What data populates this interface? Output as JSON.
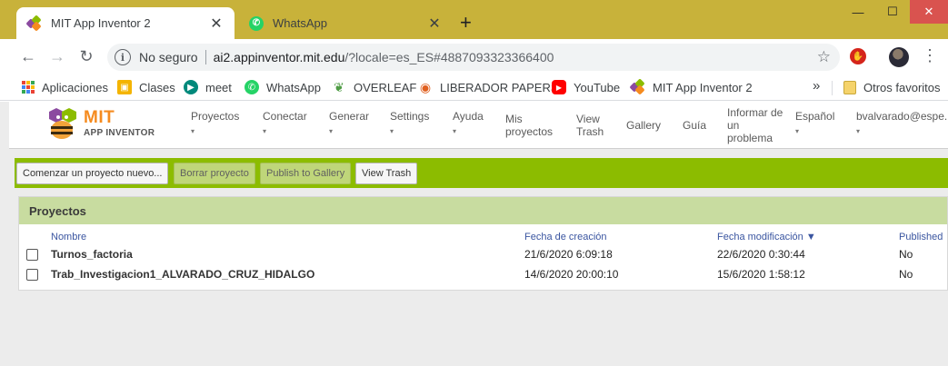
{
  "browser": {
    "tabs": [
      {
        "title": "MIT App Inventor 2",
        "close": "✕"
      },
      {
        "title": "WhatsApp",
        "close": "✕"
      }
    ],
    "new_tab": "+",
    "window_controls": {
      "minimize": "—",
      "maximize": "☐",
      "close": "✕"
    },
    "address": {
      "security_label": "No seguro",
      "url_host": "ai2.appinventor.mit.edu",
      "url_rest": "/?locale=es_ES#4887093323366400"
    },
    "bookmarks": [
      {
        "label": "Aplicaciones"
      },
      {
        "label": "Clases"
      },
      {
        "label": "meet"
      },
      {
        "label": "WhatsApp"
      },
      {
        "label": "OVERLEAF"
      },
      {
        "label": "LIBERADOR PAPERS"
      },
      {
        "label": "YouTube"
      },
      {
        "label": "MIT App Inventor 2"
      }
    ],
    "bookmarks_overflow": "»",
    "other_bookmarks": "Otros favoritos"
  },
  "app": {
    "logo": {
      "mit": "MIT",
      "subtitle": "APP INVENTOR"
    },
    "nav": [
      {
        "label": "Proyectos",
        "dropdown": true
      },
      {
        "label": "Conectar",
        "dropdown": true
      },
      {
        "label": "Generar",
        "dropdown": true
      },
      {
        "label": "Settings",
        "dropdown": true
      },
      {
        "label": "Ayuda",
        "dropdown": true
      },
      {
        "label": "Mis proyectos",
        "dropdown": false
      },
      {
        "label": "View Trash",
        "dropdown": false
      },
      {
        "label": "Gallery",
        "dropdown": false
      },
      {
        "label": "Guía",
        "dropdown": false
      },
      {
        "label": "Informar de un problema",
        "dropdown": false
      },
      {
        "label": "Español",
        "dropdown": true
      },
      {
        "label": "bvalvarado@espe.",
        "dropdown": true
      }
    ],
    "caret": "▾",
    "actions": [
      {
        "label": "Comenzar un proyecto nuevo...",
        "enabled": true
      },
      {
        "label": "Borrar proyecto",
        "enabled": false
      },
      {
        "label": "Publish to Gallery",
        "enabled": false
      },
      {
        "label": "View Trash",
        "enabled": true
      }
    ],
    "projects_panel": {
      "title": "Proyectos",
      "columns": [
        "Nombre",
        "Fecha de creación",
        "Fecha modificación ▼",
        "Published"
      ],
      "rows": [
        {
          "name": "Turnos_factoria",
          "created": "21/6/2020 6:09:18",
          "modified": "22/6/2020 0:30:44",
          "published": "No"
        },
        {
          "name": "Trab_Investigacion1_ALVARADO_CRUZ_HIDALGO",
          "created": "14/6/2020 20:00:10",
          "modified": "15/6/2020 1:58:12",
          "published": "No"
        }
      ]
    }
  }
}
